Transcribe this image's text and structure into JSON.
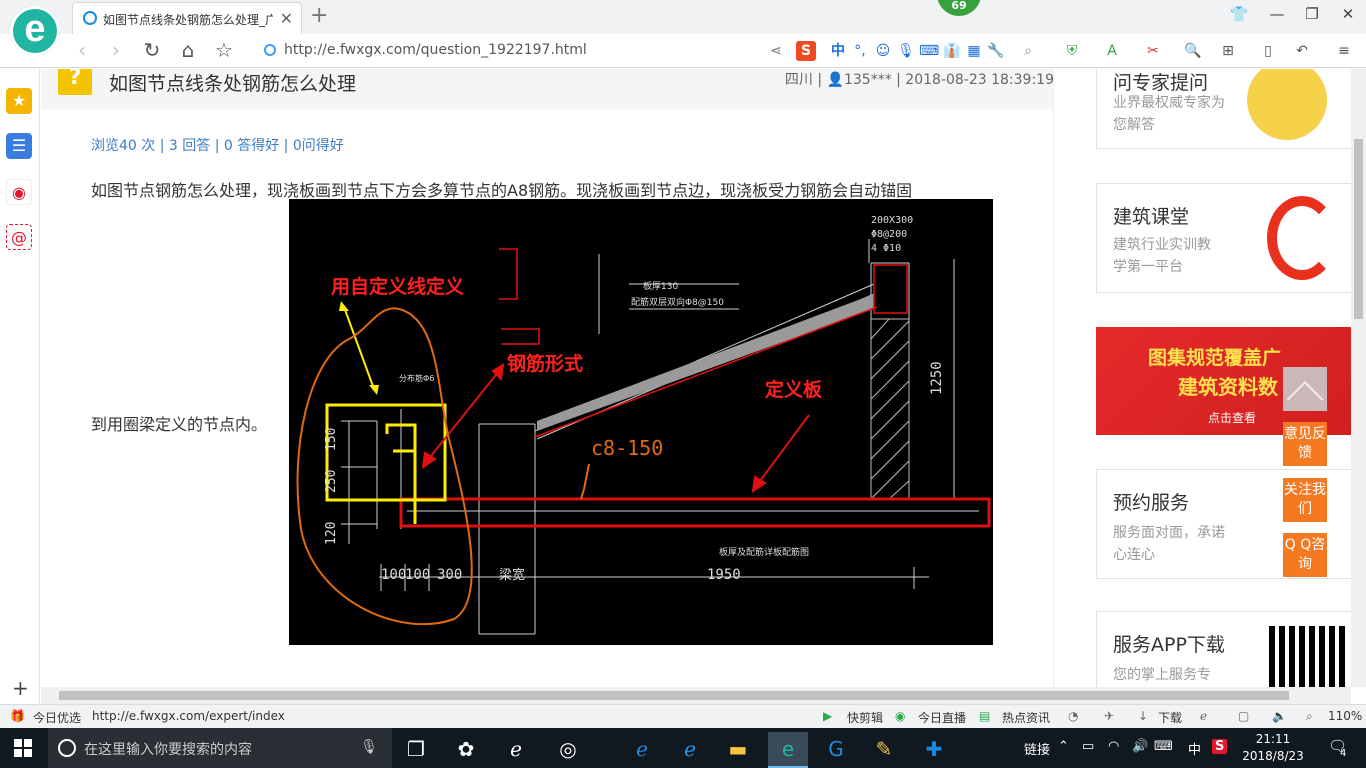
{
  "browser": {
    "tab_title": "如图节点线条处钢筋怎么处理_广",
    "tab_close": "✕",
    "new_tab": "+",
    "badge": "69",
    "url": "http://e.fwxgx.com/question_1922197.html",
    "toolbar_labels": {
      "sogou": "S",
      "zh": "中",
      "dot": "°,"
    }
  },
  "question": {
    "mark": "?",
    "title": "如图节点线条处钢筋怎么处理",
    "meta": "四川 | 👤135*** | 2018-08-23 18:39:19",
    "stats": "浏览40 次 | 3 回答 | 0 答得好 | 0问得好",
    "body_line1": "如图节点钢筋怎么处理，现浇板画到节点下方会多算节点的A8钢筋。现浇板画到节点边，现浇板受力钢筋会自动锚固",
    "body_line2": "到用圈梁定义的节点内。"
  },
  "drawing": {
    "ann_custom_line": "用自定义线定义",
    "ann_rebar_form": "钢筋形式",
    "ann_define_slab": "定义板",
    "ann_c8": "c8-150",
    "beam_size_1": "200X300",
    "beam_size_2": "Φ8@200",
    "beam_size_3": "4 Φ10",
    "slab_note_1": "板厚130",
    "slab_note_2": "配筋双层双向Φ8@150",
    "dim_1250": "1250",
    "dim_150": "150",
    "dim_250": "250",
    "dim_120": "120",
    "dim_100a": "100",
    "dim_100b": "100",
    "dim_300": "300",
    "dim_beam": "梁宽",
    "dim_1950": "1950",
    "bottom_note": "板厚及配筋详板配筋图",
    "small_note": "分布筋Φ6"
  },
  "right": {
    "card1_title": "问专家提问",
    "card1_sub": "业界最权威专家为您解答",
    "card2_title": "建筑课堂",
    "card2_sub": "建筑行业实训教学第一平台",
    "banner_line1": "图集规范覆盖广",
    "banner_line2": "建筑资料数",
    "banner_line3": "点击查看",
    "card3_title": "预约服务",
    "card3_sub": "服务面对面，承诺心连心",
    "card4_title": "服务APP下载",
    "card4_sub": "您的掌上服务专"
  },
  "float": {
    "feedback": "意见反馈",
    "follow": "关注我们",
    "qq": "Q Q咨询"
  },
  "statusbar": {
    "today_pick": "今日优选",
    "link_url": "http://e.fwxgx.com/expert/index",
    "quick_clip": "快剪辑",
    "live": "今日直播",
    "hot": "热点资讯",
    "download": "下载",
    "zoom": "110%"
  },
  "taskbar": {
    "search_placeholder": "在这里输入你要搜索的内容",
    "link_label": "链接",
    "ime": "中",
    "time": "21:11",
    "date": "2018/8/23",
    "notif": "4"
  }
}
